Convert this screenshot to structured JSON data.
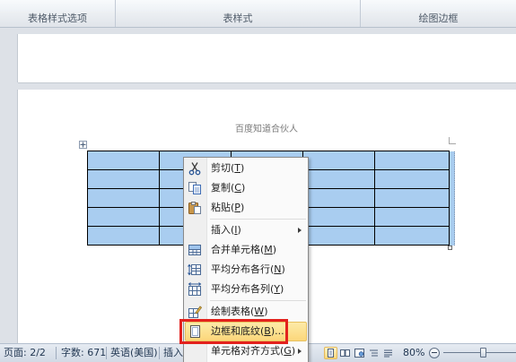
{
  "ribbon": {
    "groups": [
      {
        "label": "表格样式选项"
      },
      {
        "label": "表样式"
      },
      {
        "label": "绘图边框"
      }
    ]
  },
  "document": {
    "header_text": "百度知道合伙人"
  },
  "context_menu": {
    "items": [
      {
        "label": "剪切(T)",
        "icon": "scissors-icon"
      },
      {
        "label": "复制(C)",
        "icon": "copy-icon"
      },
      {
        "label": "粘贴(P)",
        "icon": "paste-icon"
      },
      {
        "label": "插入(I)",
        "has_submenu": true
      },
      {
        "label": "合并单元格(M)",
        "icon": "merge-cells-icon"
      },
      {
        "label": "平均分布各行(N)",
        "icon": "distribute-rows-icon"
      },
      {
        "label": "平均分布各列(Y)",
        "icon": "distribute-columns-icon"
      },
      {
        "label": "绘制表格(W)",
        "icon": "draw-table-icon"
      },
      {
        "label": "边框和底纹(B)...",
        "icon": "borders-shading-icon",
        "highlighted": true
      },
      {
        "label": "单元格对齐方式(G)",
        "has_submenu": true
      }
    ]
  },
  "status_bar": {
    "page": "页面: 2/2",
    "word_count": "字数: 671",
    "language": "英语(美国)",
    "insert_mode": "插入",
    "zoom": "80%",
    "view_buttons": [
      {
        "icon": "print-layout-icon",
        "active": true
      },
      {
        "icon": "full-screen-reading-icon"
      },
      {
        "icon": "web-layout-icon"
      },
      {
        "icon": "outline-icon"
      },
      {
        "icon": "draft-icon"
      }
    ]
  },
  "colors": {
    "cell_selection": "#a9cdf0",
    "menu_highlight": "#fbd77a",
    "callout_border": "#e3211d"
  }
}
